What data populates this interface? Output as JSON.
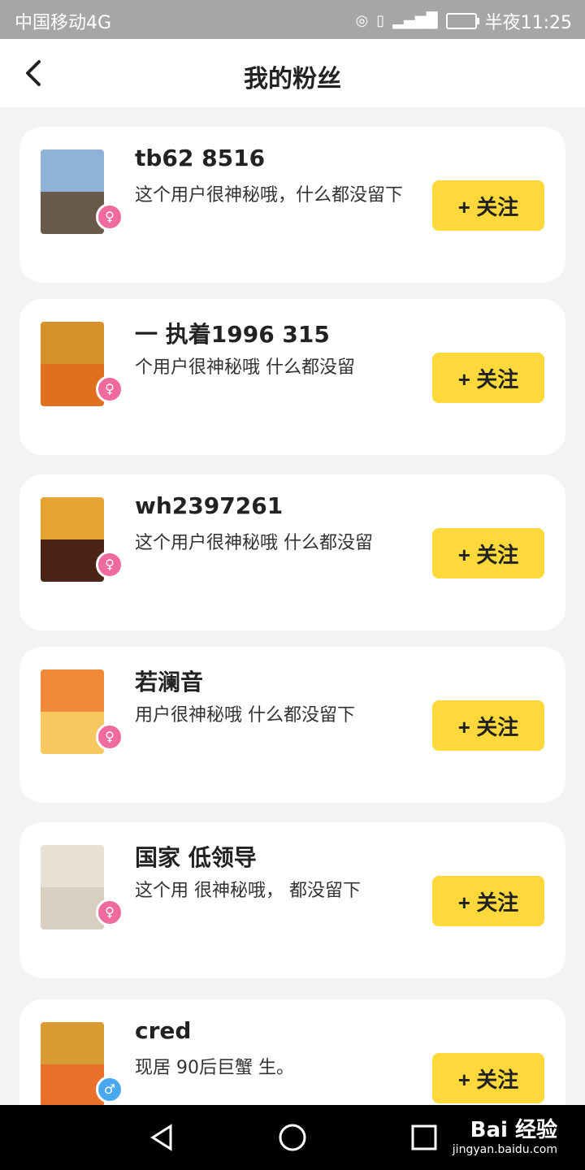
{
  "status_bar": {
    "carrier": "中国移动4G",
    "network": "4G",
    "time_label": "半夜11:25"
  },
  "header": {
    "title": "我的粉丝"
  },
  "fans": [
    {
      "name": "tb62  8516",
      "bio": "这个用户很神秘哦，什么都没留下",
      "gender": "female",
      "follow_label": "+ 关注"
    },
    {
      "name": "一 执着1996 315",
      "bio": "个用户很神秘哦 什么都没留",
      "gender": "female",
      "follow_label": "+ 关注"
    },
    {
      "name": "wh2397261",
      "bio": "这个用户很神秘哦 什么都没留",
      "gender": "female",
      "follow_label": "+ 关注"
    },
    {
      "name": "若澜音",
      "bio": "用户很神秘哦 什么都没留下",
      "gender": "female",
      "follow_label": "+ 关注"
    },
    {
      "name": "国家 低领导",
      "bio": "这个用 很神秘哦， 都没留下",
      "gender": "female",
      "follow_label": "+ 关注"
    },
    {
      "name": "cred",
      "bio": "现居 90后巨蟹 生。",
      "gender": "male",
      "follow_label": "+ 关注"
    }
  ],
  "watermark": {
    "brand": "Bai 经验",
    "url": "jingyan.baidu.com"
  },
  "colors": {
    "accent": "#ffd93b",
    "female": "#f06a9d",
    "male": "#49a9f0",
    "statusbar": "#a6a6a6"
  }
}
